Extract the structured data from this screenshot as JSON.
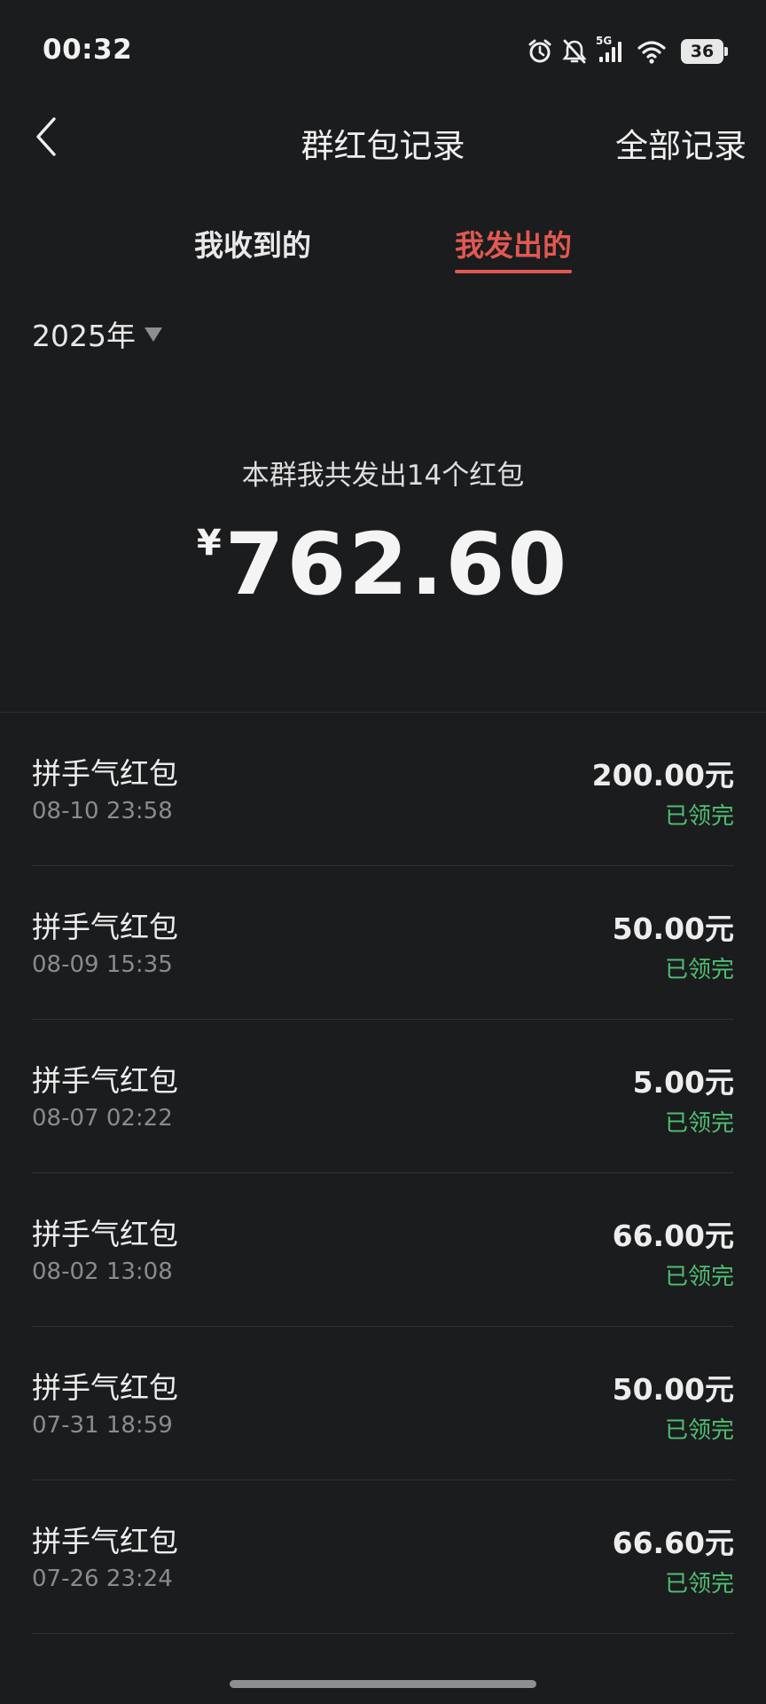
{
  "status_bar": {
    "time": "00:32",
    "signal_type": "5G",
    "battery": "36",
    "icons": [
      "alarm-icon",
      "mute-bell-icon",
      "signal-icon",
      "wifi-icon",
      "battery-icon"
    ]
  },
  "header": {
    "title": "群红包记录",
    "right_action": "全部记录",
    "back_icon": "chevron-left-icon"
  },
  "tabs": [
    {
      "label": "我收到的",
      "active": false
    },
    {
      "label": "我发出的",
      "active": true
    }
  ],
  "year_filter": {
    "label": "2025年"
  },
  "summary": {
    "caption": "本群我共发出14个红包",
    "currency": "¥",
    "amount": "762.60"
  },
  "records": [
    {
      "title": "拼手气红包",
      "time": "08-10 23:58",
      "amount": "200.00元",
      "status": "已领完"
    },
    {
      "title": "拼手气红包",
      "time": "08-09 15:35",
      "amount": "50.00元",
      "status": "已领完"
    },
    {
      "title": "拼手气红包",
      "time": "08-07 02:22",
      "amount": "5.00元",
      "status": "已领完"
    },
    {
      "title": "拼手气红包",
      "time": "08-02 13:08",
      "amount": "66.00元",
      "status": "已领完"
    },
    {
      "title": "拼手气红包",
      "time": "07-31 18:59",
      "amount": "50.00元",
      "status": "已领完"
    },
    {
      "title": "拼手气红包",
      "time": "07-26 23:24",
      "amount": "66.60元",
      "status": "已领完"
    }
  ],
  "colors": {
    "background": "#1b1c1e",
    "accent_red": "#e25852",
    "status_green": "#4fbf72",
    "secondary_text": "#8a8b8e"
  }
}
